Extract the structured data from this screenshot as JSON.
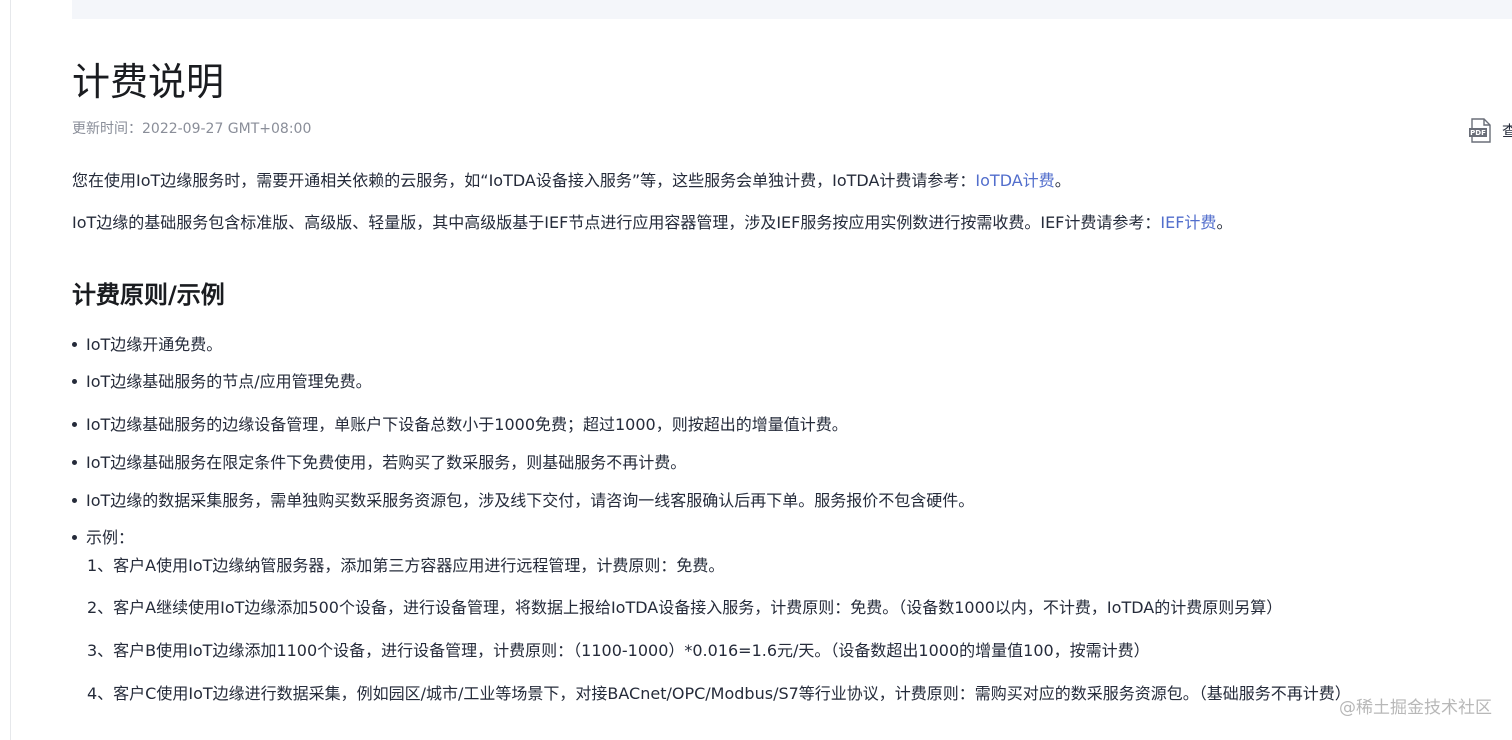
{
  "doc": {
    "title": "计费说明",
    "updated": "更新时间：2022-09-27 GMT+08:00",
    "pdf_label": "查",
    "pdf_icon_text": "PDF",
    "intro": [
      {
        "before": "您在使用IoT边缘服务时，需要开通相关依赖的云服务，如“IoTDA设备接入服务”等，这些服务会单独计费，IoTDA计费请参考：",
        "link": "IoTDA计费",
        "after": "。"
      },
      {
        "before": "IoT边缘的基础服务包含标准版、高级版、轻量版，其中高级版基于IEF节点进行应用容器管理，涉及IEF服务按应用实例数进行按需收费。IEF计费请参考：",
        "link": "IEF计费",
        "after": "。"
      }
    ],
    "section_title": "计费原则/示例",
    "bullets": [
      "IoT边缘开通免费。",
      "IoT边缘基础服务的节点/应用管理免费。",
      "IoT边缘基础服务的边缘设备管理，单账户下设备总数小于1000免费；超过1000，则按超出的增量值计费。",
      "IoT边缘基础服务在限定条件下免费使用，若购买了数采服务，则基础服务不再计费。",
      "IoT边缘的数据采集服务，需单独购买数采服务资源包，涉及线下交付，请咨询一线客服确认后再下单。服务报价不包含硬件。",
      "示例："
    ],
    "examples": [
      "1、客户A使用IoT边缘纳管服务器，添加第三方容器应用进行远程管理，计费原则：免费。",
      "2、客户A继续使用IoT边缘添加500个设备，进行设备管理，将数据上报给IoTDA设备接入服务，计费原则：免费。（设备数1000以内，不计费，IoTDA的计费原则另算）",
      "3、客户B使用IoT边缘添加1100个设备，进行设备管理，计费原则：（1100-1000）*0.016=1.6元/天。（设备数超出1000的增量值100，按需计费）",
      "4、客户C使用IoT边缘进行数据采集，例如园区/城市/工业等场景下，对接BACnet/OPC/Modbus/S7等行业协议，计费原则：需购买对应的数采服务资源包。（基础服务不再计费）"
    ]
  },
  "watermark": "@稀土掘金技术社区",
  "colors": {
    "text": "#252b3a",
    "link": "#526ecc",
    "meta": "#8a8e99",
    "banner": "#f4f6fa"
  },
  "icons": {
    "pdf": "pdf-file-icon"
  }
}
